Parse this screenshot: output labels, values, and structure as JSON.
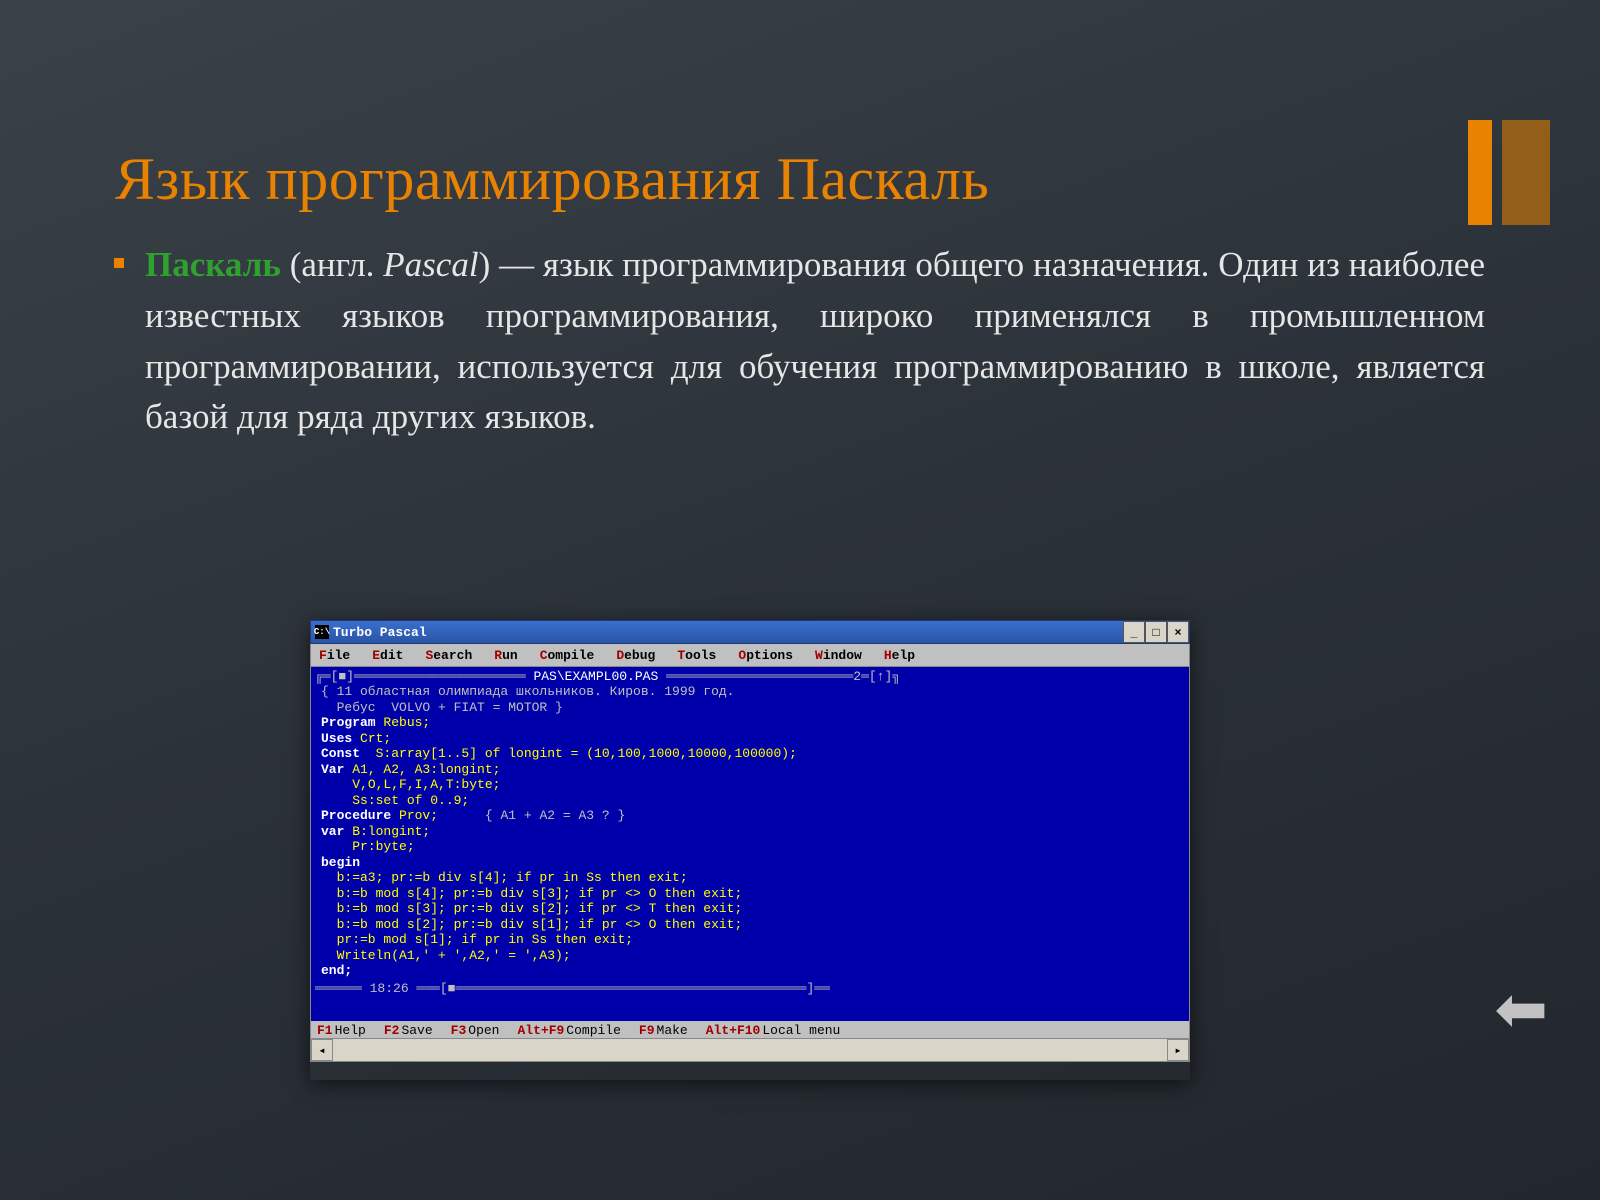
{
  "title": "Язык программирования Паскаль",
  "para": {
    "strong": "Паскаль",
    "paren_open": " (англ. ",
    "ital": "Pascal",
    "rest": ") — язык программирования общего назначения. Один из наиболее известных языков программирования, широко применялся в промышленном программировании, используется для обучения программированию в школе, является базой для ряда других языков."
  },
  "arrow": "⬅",
  "ide": {
    "win_icon": "C:\\",
    "title": "Turbo Pascal",
    "controls": {
      "min": "_",
      "max": "□",
      "close": "×"
    },
    "menu": [
      {
        "hot": "F",
        "rest": "ile"
      },
      {
        "hot": "E",
        "rest": "dit"
      },
      {
        "hot": "S",
        "rest": "earch"
      },
      {
        "hot": "R",
        "rest": "un"
      },
      {
        "hot": "C",
        "rest": "ompile"
      },
      {
        "hot": "D",
        "rest": "ebug"
      },
      {
        "hot": "T",
        "rest": "ools"
      },
      {
        "hot": "O",
        "rest": "ptions"
      },
      {
        "hot": "W",
        "rest": "indow"
      },
      {
        "hot": "H",
        "rest": "elp"
      }
    ],
    "frame_left": "╔═[■]══════════════════════ ",
    "frame_file": "PAS\\EXAMPL00.PAS",
    "frame_right": " ════════════════════════2═[↑]╗",
    "code_lines": [
      {
        "cm": "{ 11 областная олимпиада школьников. Киров. 1999 год."
      },
      {
        "cm": "  Ребус  VOLVO + FIAT = MOTOR }"
      },
      {
        "kw": "Program ",
        "id": "Rebus;"
      },
      {
        "kw": "Uses ",
        "id": "Crt;"
      },
      {
        "kw": "Const  ",
        "id": "S:array[1..5] of longint = (10,100,1000,10000,100000);"
      },
      {
        "kw": "Var ",
        "id": "A1, A2, A3:longint;"
      },
      {
        "kw": "    ",
        "id": "V,O,L,F,I,A,T:byte;"
      },
      {
        "kw": "    ",
        "id": "Ss:set of 0..9;"
      },
      {
        "kw": "Procedure ",
        "id": "Prov;      ",
        "cm": "{ A1 + A2 = A3 ? }"
      },
      {
        "kw": "var ",
        "id": "B:longint;"
      },
      {
        "kw": "    ",
        "id": "Pr:byte;"
      },
      {
        "kw": "begin"
      },
      {
        "id": "  b:=a3; pr:=b div s[4]; if pr in Ss then exit;"
      },
      {
        "id": "  b:=b mod s[4]; pr:=b div s[3]; if pr <> O then exit;"
      },
      {
        "id": "  b:=b mod s[3]; pr:=b div s[2]; if pr <> T then exit;"
      },
      {
        "id": "  b:=b mod s[2]; pr:=b div s[1]; if pr <> O then exit;"
      },
      {
        "id": "  pr:=b mod s[1]; if pr in Ss then exit;"
      },
      {
        "id": "  Writeln(A1,' + ',A2,' = ',A3);"
      },
      {
        "kw": "end;"
      }
    ],
    "clock": "══════ 18:26 ═══[■═════════════════════════════════════════════]══",
    "status": [
      {
        "k": "F1",
        "l": "Help"
      },
      {
        "k": "F2",
        "l": "Save"
      },
      {
        "k": "F3",
        "l": "Open"
      },
      {
        "k": "Alt+F9",
        "l": "Compile"
      },
      {
        "k": "F9",
        "l": "Make"
      },
      {
        "k": "Alt+F10",
        "l": "Local menu"
      }
    ],
    "scroll": {
      "left": "◂",
      "right": "▸"
    }
  }
}
